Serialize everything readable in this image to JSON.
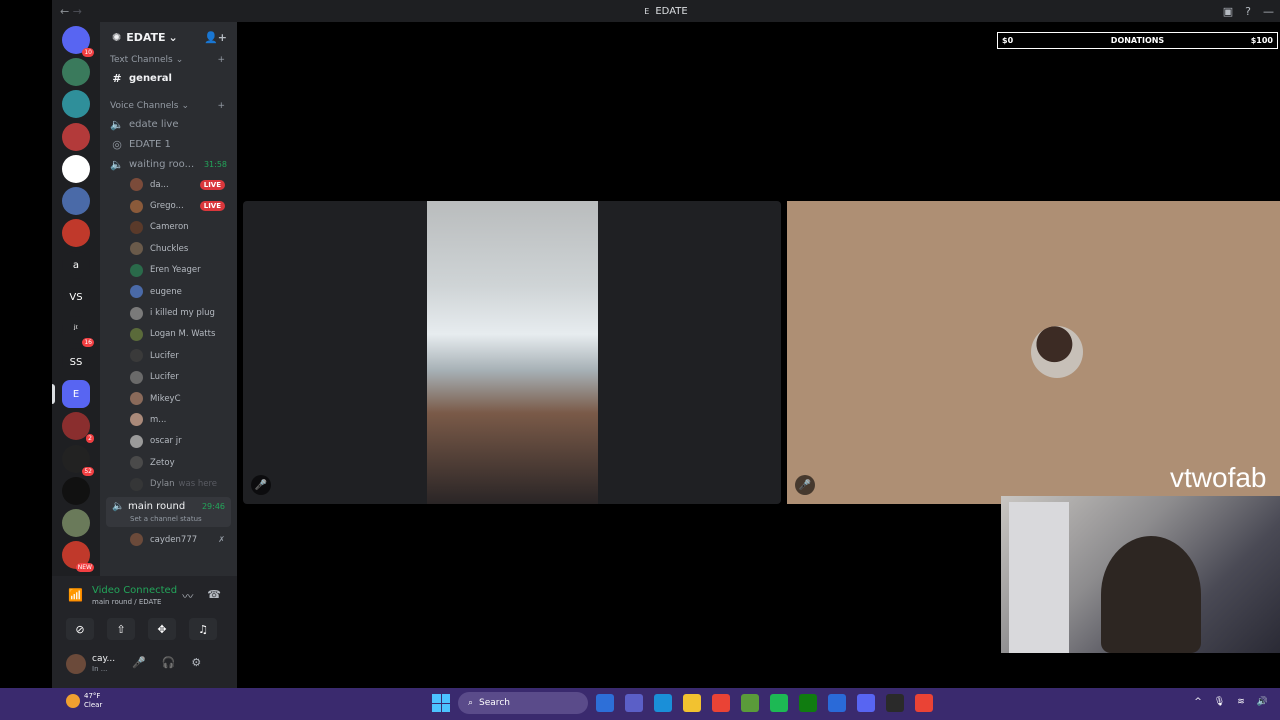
{
  "window": {
    "title": "EDATE",
    "title_icon": "E",
    "nav_back": "←",
    "nav_fwd": "→"
  },
  "guilds": [
    {
      "label": "",
      "badge": "10",
      "color": "#5865f2",
      "icon": "discord-icon"
    },
    {
      "label": "",
      "badge": "",
      "color": "#3a7a5c"
    },
    {
      "label": "",
      "badge": "",
      "color": "#2f8f9a"
    },
    {
      "label": "",
      "badge": "",
      "color": "#b33a3a"
    },
    {
      "label": "",
      "badge": "",
      "color": "#ffffff"
    },
    {
      "label": "",
      "badge": "",
      "color": "#4a6aa8"
    },
    {
      "label": "",
      "badge": "",
      "color": "#c0392b"
    },
    {
      "label": "a",
      "badge": "",
      "color": "#1e1f22"
    },
    {
      "label": "VS",
      "badge": "",
      "color": "#1e1f22"
    },
    {
      "label": "ʲᶦ",
      "badge": "16",
      "color": "#1e1f22"
    },
    {
      "label": "SS",
      "badge": "",
      "color": "#1e1f22"
    },
    {
      "label": "E",
      "badge": "",
      "color": "#5865f2"
    },
    {
      "label": "",
      "badge": "2",
      "color": "#8a2e2e"
    },
    {
      "label": "",
      "badge": "52",
      "color": "#222"
    },
    {
      "label": "",
      "badge": "",
      "color": "#111"
    },
    {
      "label": "",
      "badge": "",
      "color": "#6a7a5a"
    },
    {
      "label": "",
      "badge": "NEW",
      "color": "#c0392b"
    }
  ],
  "server": {
    "name": "EDATE",
    "dropdown": "⌄"
  },
  "text_category": "Text Channels",
  "text_channels": [
    {
      "name": "general"
    }
  ],
  "voice_category": "Voice Channels",
  "voice_channels": [
    {
      "name": "edate live"
    },
    {
      "name": "EDATE 1"
    },
    {
      "name": "waiting roo...",
      "time": "31:58"
    }
  ],
  "voice_users": [
    {
      "name": "da...",
      "live": "LIVE",
      "color": "#7b4b3a"
    },
    {
      "name": "Grego...",
      "live": "LIVE",
      "color": "#8a5a3a"
    },
    {
      "name": "Cameron",
      "color": "#5a3a2a"
    },
    {
      "name": "Chuckles",
      "color": "#6a5a4a"
    },
    {
      "name": "Eren Yeager",
      "color": "#2a6a4a"
    },
    {
      "name": "eugene",
      "color": "#4a6aa8"
    },
    {
      "name": "i killed my plug",
      "color": "#7a7a7a"
    },
    {
      "name": "Logan M. Watts",
      "color": "#5a6a3a"
    },
    {
      "name": "Lucifer",
      "color": "#3a3a3a"
    },
    {
      "name": "Lucifer",
      "color": "#6a6a6a"
    },
    {
      "name": "MikeyC",
      "color": "#8a6a5a"
    },
    {
      "name": "m...",
      "color": "#aa8a7a"
    },
    {
      "name": "oscar jr",
      "color": "#9a9a9a"
    },
    {
      "name": "Zetoy",
      "color": "#4a4a4a"
    },
    {
      "name": "Dylan",
      "status": "was here",
      "color": "#3a3a3a"
    }
  ],
  "main_round": {
    "name": "main round",
    "time": "29:46",
    "status": "Set a channel status"
  },
  "main_round_user": {
    "name": "cayden777"
  },
  "voice_panel": {
    "status": "Video Connected",
    "location": "main round / EDATE"
  },
  "user": {
    "name": "cay...",
    "status": "In ..."
  },
  "donations": {
    "min": "$0",
    "label": "DONATIONS",
    "max": "$100",
    "progress": 0
  },
  "overlay": {
    "watermark": "vtwofab"
  },
  "taskbar": {
    "weather_temp": "47°F",
    "weather_desc": "Clear",
    "search": "Search",
    "apps": [
      "file-explorer",
      "teams",
      "edge",
      "folder",
      "chrome",
      "minecraft",
      "spotify",
      "xbox",
      "store",
      "discord",
      "obs",
      "chrome-2"
    ]
  }
}
